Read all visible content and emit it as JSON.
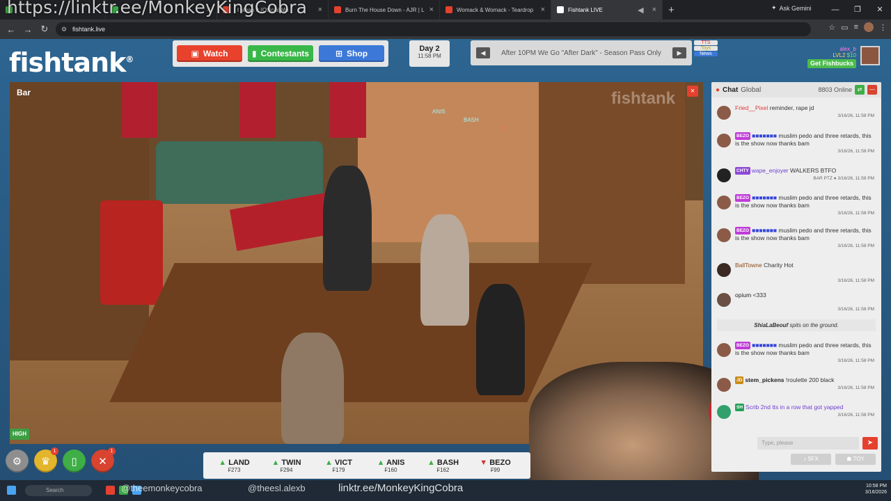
{
  "browser": {
    "overlay_link": "https://linktr.ee/MonkeyKingCobra",
    "tabs": [
      {
        "title": "",
        "color": "#3ba845"
      },
      {
        "title": "",
        "color": "#d8442f"
      },
      {
        "title": "- I Mean It (Official Mu",
        "color": "#e5412e"
      },
      {
        "title": "Burn The House Down - AJR | L",
        "color": "#e5412e"
      },
      {
        "title": "Womack & Womack - Teardrop",
        "color": "#e5412e"
      },
      {
        "title": "Fishtank LIVE",
        "color": "#ffffff"
      }
    ],
    "ask_gemini": "Ask Gemini",
    "url": "fishtank.live"
  },
  "site": {
    "logo": "fishtank",
    "logo_mark": "®",
    "nav": {
      "watch": "Watch",
      "contestants": "Contestants",
      "shop": "Shop"
    },
    "day": {
      "label": "Day 2",
      "time": "11:58 PM"
    },
    "ticker": "After 10PM We Go \"After Dark\" - Season Pass Only",
    "tags": {
      "tts": "TTS",
      "toys": "Toys",
      "news": "News"
    },
    "user": {
      "name": "alex_b",
      "level": "LVL2",
      "balance": "$10",
      "fishbucks": "Get Fishbucks"
    }
  },
  "video": {
    "label": "Bar",
    "watermark": "fishtank",
    "overlay_texts": [
      "ANIS",
      "BASH",
      "B"
    ],
    "quality": "HIGH",
    "close": "×"
  },
  "bottombar": {
    "badge1": "1",
    "badge2": "1",
    "stocks": [
      {
        "name": "LAND",
        "price": "₣273",
        "dir": "up",
        "arrow": "▲"
      },
      {
        "name": "TWIN",
        "price": "₣294",
        "dir": "up",
        "arrow": "▲"
      },
      {
        "name": "VICT",
        "price": "₣179",
        "dir": "up",
        "arrow": "▲"
      },
      {
        "name": "ANIS",
        "price": "₣160",
        "dir": "up",
        "arrow": "▲"
      },
      {
        "name": "BASH",
        "price": "₣162",
        "dir": "up",
        "arrow": "▲"
      },
      {
        "name": "BEZO",
        "price": "₣99",
        "dir": "down",
        "arrow": "▼"
      }
    ]
  },
  "chat": {
    "title": "Chat",
    "scope": "Global",
    "online": "8803 Online",
    "messages": [
      {
        "user": "Fried__Pixel",
        "badge": "",
        "text": "reminder, rape jd",
        "ts": "3/16/26, 11:58 PM"
      },
      {
        "user": "",
        "badge": "BEZO",
        "text": "muslim pedo and three retards, this is the show now thanks bam",
        "ts": "3/16/26, 11:58 PM"
      },
      {
        "user": "wape_enjoyer",
        "badge": "CHTY",
        "text": "WALKERS BTFO",
        "ts": "BAR PTZ ● 3/16/26, 11:58 PM"
      },
      {
        "user": "",
        "badge": "BEZO",
        "text": "muslim pedo and three retards, this is the show now thanks bam",
        "ts": "3/16/26, 11:58 PM"
      },
      {
        "user": "",
        "badge": "BEZO",
        "text": "muslim pedo and three retards, this is the show now thanks bam",
        "ts": "3/16/26, 11:58 PM"
      },
      {
        "user": "BallTowne",
        "badge": "",
        "text": "Charity Hot",
        "ts": "3/16/26, 11:58 PM"
      },
      {
        "user": "opium",
        "badge": "",
        "text": "<333",
        "ts": "3/16/26, 11:58 PM"
      },
      {
        "user": "",
        "badge": "BEZO",
        "text": "muslim pedo and three retards, this is the show now thanks bam",
        "ts": "3/16/26, 11:58 PM"
      },
      {
        "user": "stem_pickens",
        "badge": "JD",
        "text": "!roulette 200 black",
        "ts": "3/16/26, 11:58 PM"
      },
      {
        "user": "Scrib",
        "badge": "SH",
        "text": "2nd tts in a row that got yapped",
        "ts": "3/16/26, 11:58 PM"
      }
    ],
    "system": {
      "actor": "ShiaLaBeouf",
      "text": "spits on the ground."
    },
    "input_placeholder": "Type, please",
    "sfx": "SFX",
    "toy": "TOY"
  },
  "taskbar": {
    "search": "Search",
    "handle1": "@theemonkeycobra",
    "handle2": "@theesl.alexb",
    "link": "linktr.ee/MonkeyKingCobra",
    "clock_time": "10:58 PM",
    "clock_date": "3/16/2026"
  }
}
